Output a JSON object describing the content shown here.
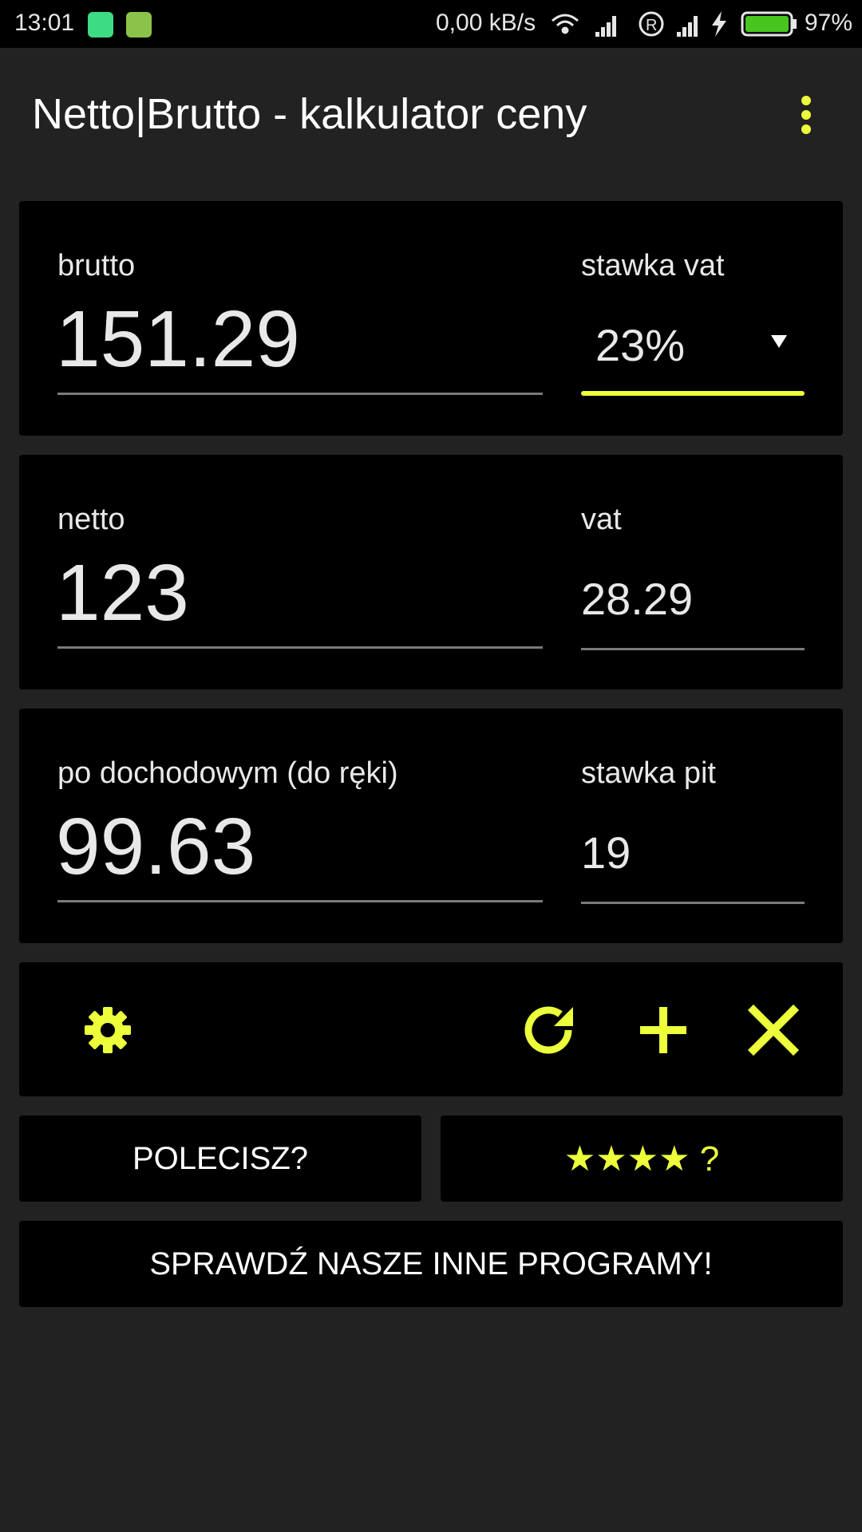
{
  "status_bar": {
    "time": "13:01",
    "network_speed": "0,00 kB/s",
    "battery": "97%"
  },
  "app_bar": {
    "title": "Netto|Brutto - kalkulator ceny",
    "menu_icon": "overflow-menu-icon"
  },
  "gross_card": {
    "label": "brutto",
    "value": "151.29",
    "vat_rate_label": "stawka vat",
    "vat_rate_value": "23%"
  },
  "net_card": {
    "label": "netto",
    "value": "123",
    "vat_label": "vat",
    "vat_value": "28.29"
  },
  "income_card": {
    "label": "po dochodowym (do ręki)",
    "value": "99.63",
    "pit_rate_label": "stawka pit",
    "pit_rate_value": "19"
  },
  "toolbar": {
    "icons": [
      "gear-icon",
      "refresh-icon",
      "plus-icon",
      "close-icon"
    ]
  },
  "buttons": {
    "recommend": "POLECISZ?",
    "rate": "★★★★ ?",
    "other_programs": "SPRAWDŹ NASZE INNE PROGRAMY!"
  },
  "colors": {
    "accent": "#ecff3a",
    "background": "#222222",
    "card": "#000000"
  }
}
